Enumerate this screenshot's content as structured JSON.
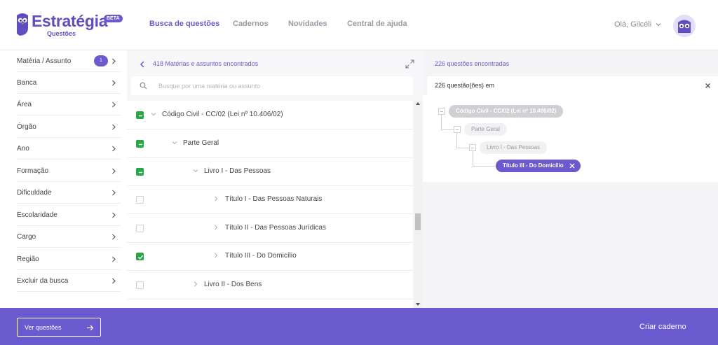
{
  "brand": {
    "name": "Estratégia",
    "subtitle": "Questões",
    "beta": "BETA",
    "accent": "#6a5acd"
  },
  "nav": {
    "items": [
      {
        "label": "Busca de questões",
        "active": true
      },
      {
        "label": "Cadernos",
        "active": false
      },
      {
        "label": "Novidades",
        "active": false
      },
      {
        "label": "Central de ajuda",
        "active": false
      }
    ],
    "greeting": "Olá, Gilcéli"
  },
  "filters": {
    "items": [
      {
        "label": "Matéria / Assunto",
        "badge": "1"
      },
      {
        "label": "Banca"
      },
      {
        "label": "Área"
      },
      {
        "label": "Órgão"
      },
      {
        "label": "Ano"
      },
      {
        "label": "Formação"
      },
      {
        "label": "Dificuldade"
      },
      {
        "label": "Escolaridade"
      },
      {
        "label": "Cargo"
      },
      {
        "label": "Região"
      },
      {
        "label": "Excluir da busca"
      }
    ]
  },
  "middle": {
    "count_text": "418 Matérias e assuntos encontrados",
    "search_placeholder": "Busque por uma matéria ou assunto",
    "tree": [
      {
        "label": "Código Civil - CC/02 (Lei nº 10.406/02)",
        "level": 0,
        "checked": true,
        "toggle": "collapse"
      },
      {
        "label": "Parte Geral",
        "level": 1,
        "checked": true,
        "toggle": "collapse"
      },
      {
        "label": "Livro I - Das Pessoas",
        "level": 2,
        "checked": true,
        "toggle": "collapse"
      },
      {
        "label": "Título I - Das Pessoas Naturais",
        "level": 3,
        "checked": false,
        "toggle": "expand"
      },
      {
        "label": "Título II - Das Pessoas Jurídicas",
        "level": 3,
        "checked": false,
        "toggle": "expand"
      },
      {
        "label": "Título III - Do Domicílio",
        "level": 3,
        "checked": true,
        "toggle": "expand"
      },
      {
        "label": "Livro II - Dos Bens",
        "level": 2,
        "checked": false,
        "toggle": "expand"
      }
    ]
  },
  "right": {
    "count_text": "226 questões encontradas",
    "summary_text": "226 questão(ões) em",
    "breadcrumb": [
      "Código Civil - CC/02 (Lei nº 10.406/02)",
      "Parte Geral",
      "Livro I - Das Pessoas",
      "Título III - Do Domicílio"
    ]
  },
  "footer": {
    "ver_questoes": "Ver questões",
    "criar_caderno": "Criar caderno"
  }
}
